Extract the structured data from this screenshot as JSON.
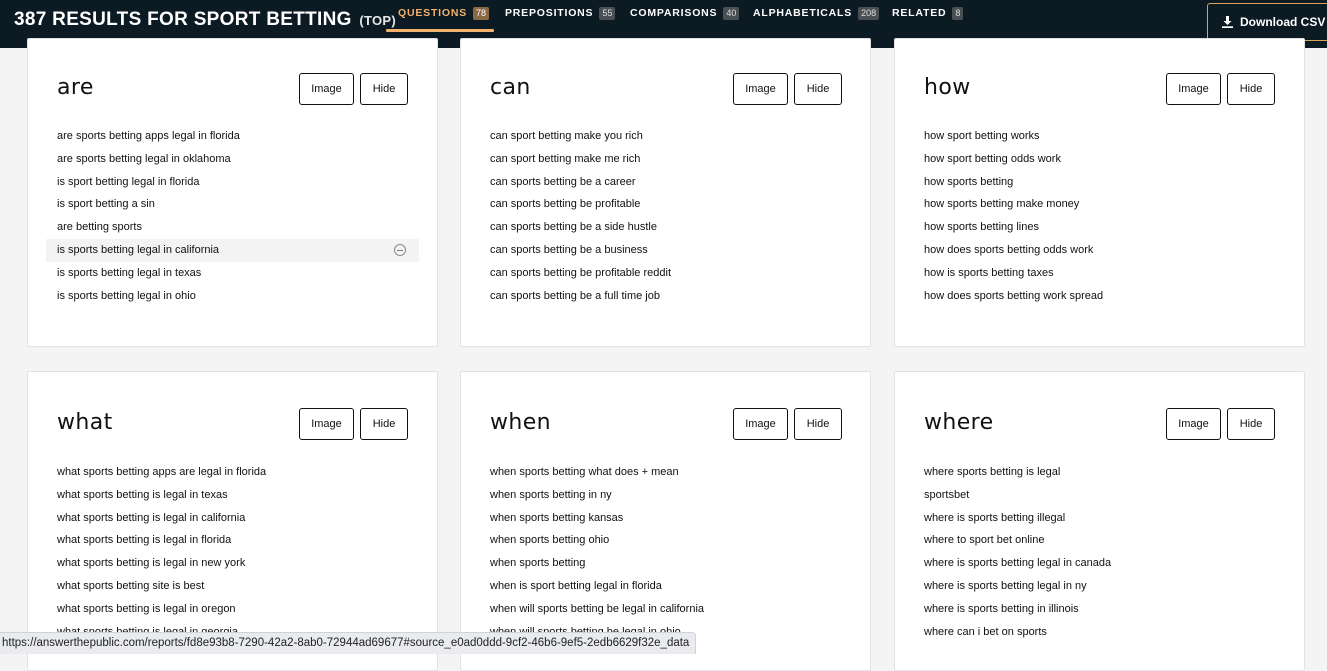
{
  "header": {
    "title_main": "387 RESULTS FOR SPORT BETTING",
    "title_suffix": "(TOP)",
    "tabs": [
      {
        "label": "QUESTIONS",
        "count": "78"
      },
      {
        "label": "PREPOSITIONS",
        "count": "55"
      },
      {
        "label": "COMPARISONS",
        "count": "40"
      },
      {
        "label": "ALPHABETICALS",
        "count": "208"
      },
      {
        "label": "RELATED",
        "count": "8"
      }
    ],
    "download_label": "Download CSV"
  },
  "buttons": {
    "image": "Image",
    "hide": "Hide"
  },
  "cards": [
    {
      "title": "are",
      "items": [
        "are sports betting apps legal in florida",
        "are sports betting legal in oklahoma",
        "is sport betting legal in florida",
        "is sport betting a sin",
        "are betting sports",
        "is sports betting legal in california",
        "is sports betting legal in texas",
        "is sports betting legal in ohio"
      ]
    },
    {
      "title": "can",
      "items": [
        "can sport betting make you rich",
        "can sport betting make me rich",
        "can sports betting be a career",
        "can sports betting be profitable",
        "can sports betting be a side hustle",
        "can sports betting be a business",
        "can sports betting be profitable reddit",
        "can sports betting be a full time job"
      ]
    },
    {
      "title": "how",
      "items": [
        "how sport betting works",
        "how sport betting odds work",
        "how sports betting",
        "how sports betting make money",
        "how sports betting lines",
        "how does sports betting odds work",
        "how is sports betting taxes",
        "how does sports betting work spread"
      ]
    },
    {
      "title": "what",
      "items": [
        "what sports betting apps are legal in florida",
        "what sports betting is legal in texas",
        "what sports betting is legal in california",
        "what sports betting is legal in florida",
        "what sports betting is legal in new york",
        "what sports betting site is best",
        "what sports betting is legal in oregon",
        "what sports betting is legal in georgia"
      ]
    },
    {
      "title": "when",
      "items": [
        "when sports betting what does + mean",
        "when sports betting in ny",
        "when sports betting kansas",
        "when sports betting ohio",
        "when sports betting",
        "when is sport betting legal in florida",
        "when will sports betting be legal in california",
        "when will sports betting be legal in ohio"
      ]
    },
    {
      "title": "where",
      "items": [
        "where sports betting is legal",
        "sportsbet",
        "where is sports betting illegal",
        "where to sport bet online",
        "where is sports betting legal in canada",
        "where is sports betting legal in ny",
        "where is sports betting in illinois",
        "where can i bet on sports"
      ]
    }
  ],
  "status_url": "https://answerthepublic.com/reports/fd8e93b8-7290-42a2-8ab0-72944ad69677#source_e0ad0ddd-9cf2-46b6-9ef5-2edb6629f32e_data"
}
